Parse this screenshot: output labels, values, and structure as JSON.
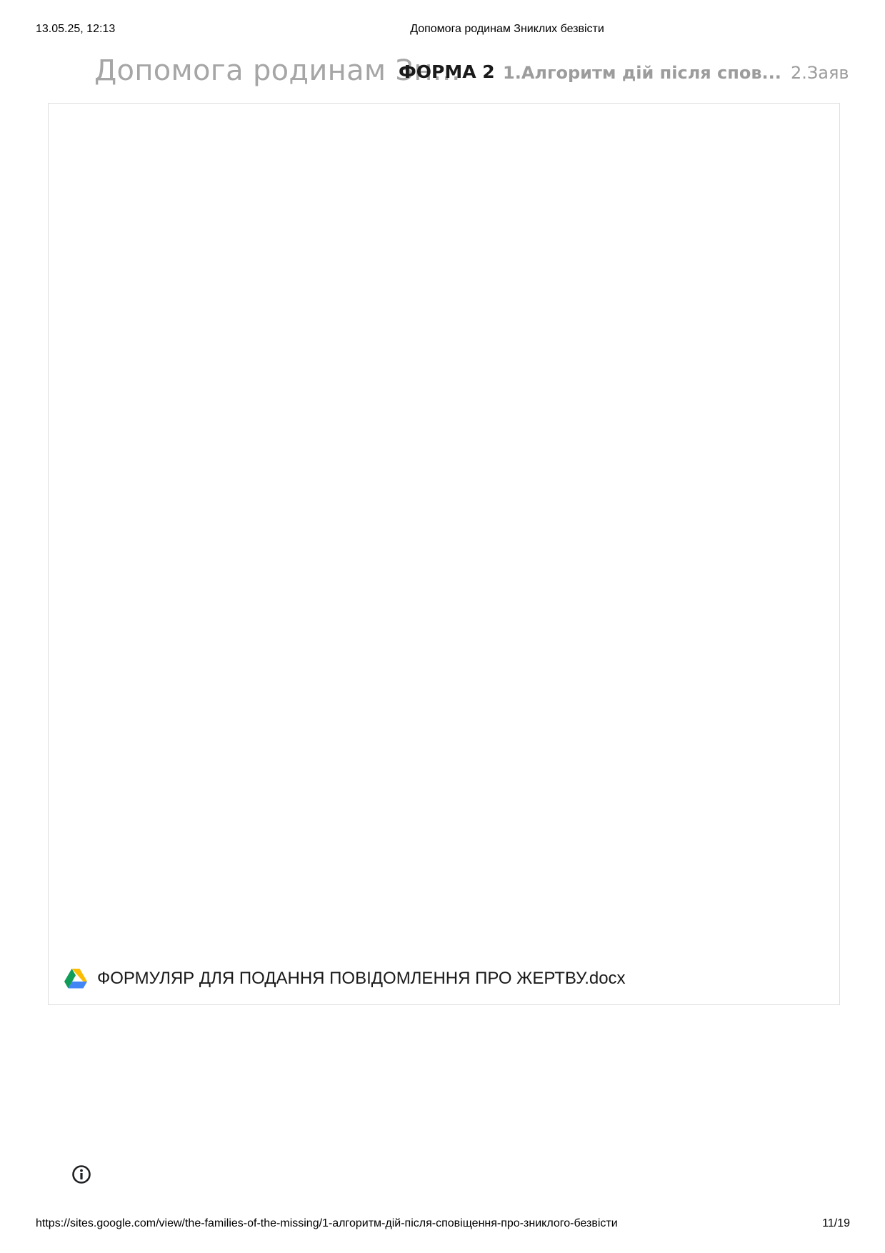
{
  "print_header": {
    "datetime": "13.05.25, 12:13",
    "page_title": "Допомога родинам Зниклих безвісти"
  },
  "site_header": {
    "site_title": "Допомога родинам Зн...",
    "nav": {
      "current": "ФОРМА 2",
      "items": [
        "1.Алгоритм дій після спов...",
        "2.Заяв"
      ]
    }
  },
  "embed": {
    "file_name": "ФОРМУЛЯР ДЛЯ ПОДАННЯ ПОВІДОМЛЕННЯ ПРО ЖЕРТВУ.docx",
    "file_icon": "google-drive-icon"
  },
  "info_icon": "info-icon",
  "print_footer": {
    "url": "https://sites.google.com/view/the-families-of-the-missing/1-алгоритм-дій-після-сповіщення-про-зниклого-безвісти",
    "page_number": "11/19"
  }
}
